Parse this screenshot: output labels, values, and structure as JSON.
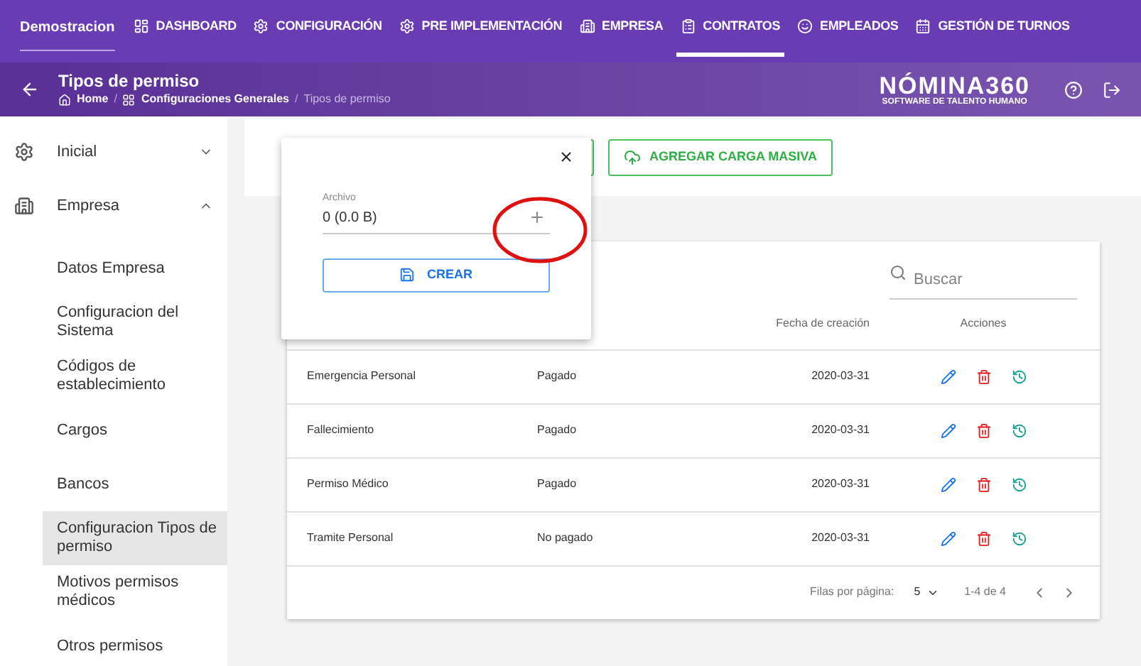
{
  "nav": {
    "brand": "Demostracion",
    "tabs": [
      {
        "label": "DASHBOARD",
        "selected": false
      },
      {
        "label": "CONFIGURACIÓN",
        "selected": false
      },
      {
        "label": "PRE IMPLEMENTACIÓN",
        "selected": false
      },
      {
        "label": "EMPRESA",
        "selected": false
      },
      {
        "label": "CONTRATOS",
        "selected": true
      },
      {
        "label": "EMPLEADOS",
        "selected": false
      },
      {
        "label": "GESTIÓN DE TURNOS",
        "selected": false
      }
    ]
  },
  "header": {
    "title": "Tipos de permiso",
    "breadcrumb": [
      "Home",
      "Configuraciones Generales",
      "Tipos de permiso"
    ],
    "breadcrumb_separator": "/",
    "logo": {
      "name": "NÓMINA360",
      "tagline": "SOFTWARE DE TALENTO HUMANO"
    }
  },
  "sidebar": {
    "items": [
      {
        "label": "Inicial",
        "expanded": false
      },
      {
        "label": "Empresa",
        "expanded": true,
        "children": [
          {
            "label": "Datos Empresa",
            "selected": false
          },
          {
            "label": "Configuracion del Sistema",
            "selected": false
          },
          {
            "label": "Códigos de establecimiento",
            "selected": false
          },
          {
            "label": "Cargos",
            "selected": false
          },
          {
            "label": "Bancos",
            "selected": false
          },
          {
            "label": "Configuracion Tipos de permiso",
            "selected": true
          },
          {
            "label": "Motivos permisos médicos",
            "selected": false
          },
          {
            "label": "Otros permisos",
            "selected": false
          }
        ]
      }
    ]
  },
  "toolbar": {
    "bulk_button": "AGREGAR CARGA MASIVA"
  },
  "popup": {
    "field_label": "Archivo",
    "field_value": "0 (0.0 B)",
    "submit": "CREAR"
  },
  "table": {
    "search_placeholder": "Buscar",
    "columns": [
      "Fecha de creación",
      "Acciones"
    ],
    "rows": [
      {
        "name": "Emergencia Personal",
        "status": "Pagado",
        "date": "2020-03-31"
      },
      {
        "name": "Fallecimiento",
        "status": "Pagado",
        "date": "2020-03-31"
      },
      {
        "name": "Permiso Médico",
        "status": "Pagado",
        "date": "2020-03-31"
      },
      {
        "name": "Tramite Personal",
        "status": "No pagado",
        "date": "2020-03-31"
      }
    ],
    "pagination": {
      "rows_label": "Filas por página:",
      "rows_value": "5",
      "range": "1-4 de 4"
    }
  }
}
